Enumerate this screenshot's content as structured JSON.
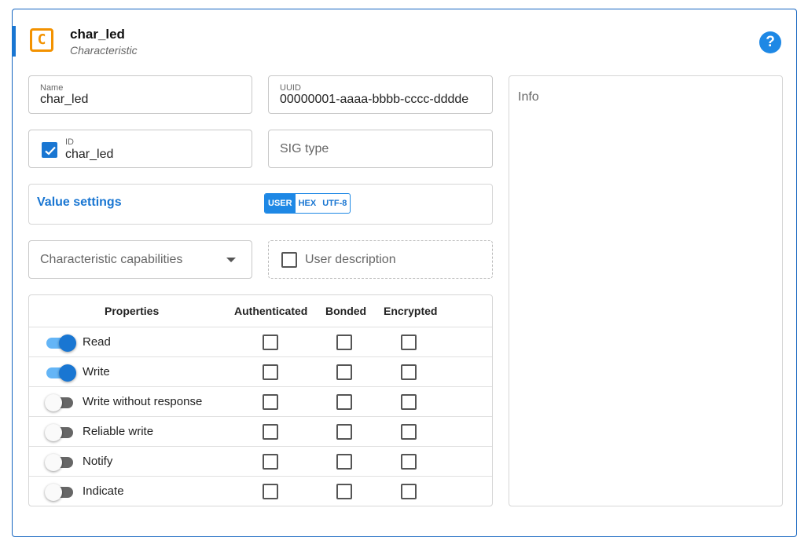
{
  "header": {
    "title": "char_led",
    "subtitle": "Characteristic",
    "icon_letter": "C",
    "help_symbol": "?"
  },
  "fields": {
    "name": {
      "label": "Name",
      "value": "char_led"
    },
    "uuid": {
      "label": "UUID",
      "value": "00000001-aaaa-bbbb-cccc-dddde"
    },
    "id": {
      "label": "ID",
      "value": "char_led",
      "checked": true
    },
    "sig_type": {
      "placeholder": "SIG type"
    }
  },
  "value_settings": {
    "label": "Value settings",
    "options": [
      "USER",
      "HEX",
      "UTF-8"
    ],
    "selected": "USER"
  },
  "capabilities": {
    "placeholder": "Characteristic capabilities"
  },
  "user_description": {
    "label": "User description",
    "checked": false
  },
  "properties_table": {
    "headers": [
      "Properties",
      "Authenticated",
      "Bonded",
      "Encrypted"
    ],
    "rows": [
      {
        "label": "Read",
        "enabled": true
      },
      {
        "label": "Write",
        "enabled": true
      },
      {
        "label": "Write without response",
        "enabled": false
      },
      {
        "label": "Reliable write",
        "enabled": false
      },
      {
        "label": "Notify",
        "enabled": false
      },
      {
        "label": "Indicate",
        "enabled": false
      }
    ]
  },
  "info": {
    "label": "Info"
  },
  "colors": {
    "accent": "#1976d2",
    "icon": "#f39200",
    "border": "#1565c0"
  }
}
